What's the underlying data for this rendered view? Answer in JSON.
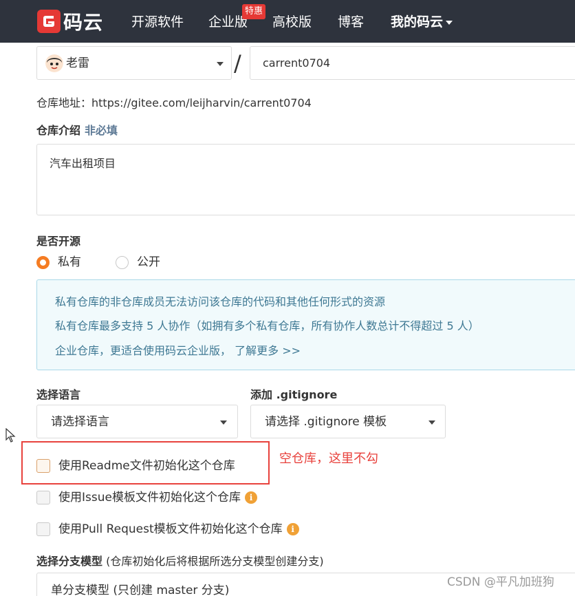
{
  "nav": {
    "logo_text": "码云",
    "items": [
      "开源软件",
      "企业版",
      "高校版",
      "博客",
      "我的码云"
    ],
    "badge": "特惠"
  },
  "owner": {
    "name": "老雷"
  },
  "slash": "/",
  "repo": {
    "name": "carrent0704"
  },
  "repo_url": "仓库地址：https://gitee.com/leijharvin/carrent0704",
  "description": {
    "label": "仓库介绍",
    "optional": "非必填",
    "value": "汽车出租项目"
  },
  "visibility": {
    "label": "是否开源",
    "options": [
      "私有",
      "公开"
    ],
    "selected": "私有"
  },
  "info": {
    "line1": "私有仓库的非仓库成员无法访问该仓库的代码和其他任何形式的资源",
    "line2": "私有仓库最多支持 5 人协作（如拥有多个私有仓库，所有协作人数总计不得超过 5 人）",
    "line3": "企业仓库，更适合使用码云企业版，",
    "link": "了解更多 >>"
  },
  "language": {
    "label": "选择语言",
    "value": "请选择语言"
  },
  "gitignore": {
    "label": "添加 .gitignore",
    "value": "请选择 .gitignore 模板"
  },
  "checkboxes": [
    "使用Readme文件初始化这个仓库",
    "使用Issue模板文件初始化这个仓库",
    "使用Pull Request模板文件初始化这个仓库"
  ],
  "info_icon": "i",
  "annotation": "空仓库，这里不勾",
  "branch": {
    "label": "选择分支模型",
    "hint": "(仓库初始化后将根据所选分支模型创建分支)",
    "value": "单分支模型 (只创建 master 分支)"
  },
  "watermark": "CSDN @平凡加班狗",
  "colors": {
    "nav_bg": "#2e333d",
    "accent_orange": "#f57c22",
    "annotation_red": "#e8413c",
    "info_bg": "#f1fafc",
    "info_text": "#3e7893"
  }
}
